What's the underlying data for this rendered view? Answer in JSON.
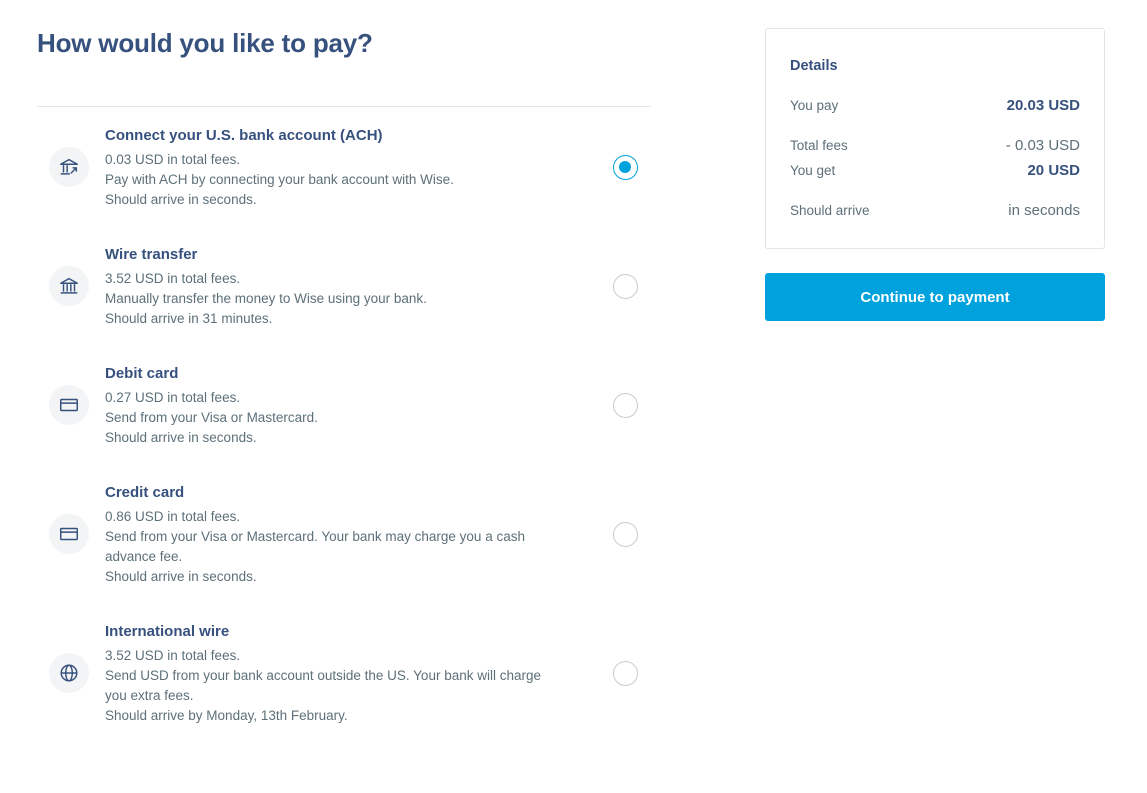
{
  "page": {
    "title": "How would you like to pay?"
  },
  "methods": [
    {
      "name": "Connect your U.S. bank account (ACH)",
      "icon": "bank-connect-icon",
      "selected": true,
      "lines": [
        "0.03 USD in total fees.",
        "Pay with ACH by connecting your bank account with Wise.",
        "Should arrive in seconds."
      ]
    },
    {
      "name": "Wire transfer",
      "icon": "bank-icon",
      "selected": false,
      "lines": [
        "3.52 USD in total fees.",
        "Manually transfer the money to Wise using your bank.",
        "Should arrive in 31 minutes."
      ]
    },
    {
      "name": "Debit card",
      "icon": "card-icon",
      "selected": false,
      "lines": [
        "0.27 USD in total fees.",
        "Send from your Visa or Mastercard.",
        "Should arrive in seconds."
      ]
    },
    {
      "name": "Credit card",
      "icon": "card-icon",
      "selected": false,
      "lines": [
        "0.86 USD in total fees.",
        "Send from your Visa or Mastercard. Your bank may charge you a cash",
        "advance fee.",
        "Should arrive in seconds."
      ]
    },
    {
      "name": "International wire",
      "icon": "globe-icon",
      "selected": false,
      "lines": [
        "3.52 USD in total fees.",
        "Send USD from your bank account outside the US. Your bank will charge",
        "you extra fees.",
        "Should arrive by Monday, 13th February."
      ]
    }
  ],
  "details": {
    "heading": "Details",
    "you_pay_label": "You pay",
    "you_pay_value": "20.03 USD",
    "total_fees_label": "Total fees",
    "total_fees_value": "- 0.03 USD",
    "you_get_label": "You get",
    "you_get_value": "20 USD",
    "should_arrive_label": "Should arrive",
    "should_arrive_value": "in seconds"
  },
  "continue_button": {
    "label": "Continue to payment"
  },
  "colors": {
    "accent": "#00a2dd",
    "title": "#37517e",
    "body_text": "#5d7079"
  }
}
